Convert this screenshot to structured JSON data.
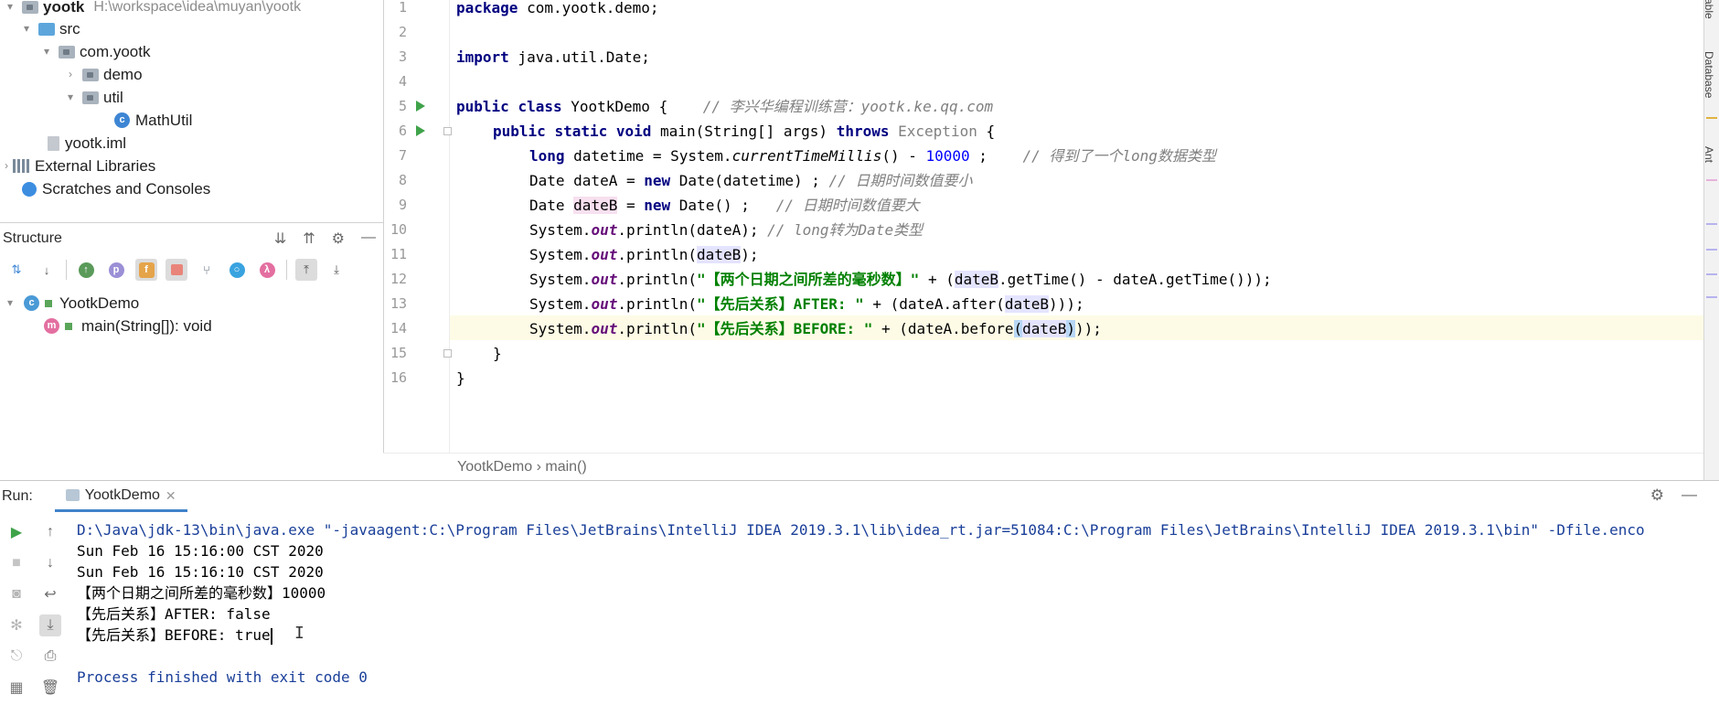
{
  "project": {
    "root_name": "yootk",
    "root_path": "H:\\workspace\\idea\\muyan\\yootk",
    "items": [
      {
        "label": "src"
      },
      {
        "label": "com.yootk"
      },
      {
        "label": "demo"
      },
      {
        "label": "util"
      },
      {
        "label": "MathUtil"
      },
      {
        "label": "yootk.iml"
      },
      {
        "label": "External Libraries"
      },
      {
        "label": "Scratches and Consoles"
      }
    ]
  },
  "structure": {
    "title": "Structure",
    "nodes": [
      {
        "label": "YootkDemo"
      },
      {
        "label": "main(String[]): void"
      }
    ],
    "icon_letters": [
      "p",
      "f",
      "λ"
    ]
  },
  "editor": {
    "line_numbers": [
      "1",
      "2",
      "3",
      "4",
      "5",
      "6",
      "7",
      "8",
      "9",
      "10",
      "11",
      "12",
      "13",
      "14",
      "15",
      "16"
    ],
    "lines": [
      {
        "k1": "package",
        "t1": " com.yootk.demo;"
      },
      {},
      {
        "k1": "import",
        "t1": " java.util.Date;"
      },
      {},
      {
        "k1": "public",
        "t1": " ",
        "k2": "class",
        "t2": " YootkDemo {    ",
        "cmt": "// 李兴华编程训练营：yootk.ke.qq.com"
      },
      {
        "k1": "public",
        "t1": " ",
        "k2": "static",
        "t2": " ",
        "k3": "void",
        "t3": " main(String[] args) ",
        "k4": "throws",
        "t4": " ",
        "gray": "Exception",
        "t5": " {"
      },
      {
        "k1": "long",
        "t1": " datetime = System.",
        "stat": "currentTimeMillis",
        "t2": "() - ",
        "num": "10000",
        "t3": " ;    ",
        "cmt": "// 得到了一个long数据类型"
      },
      {
        "t1": "Date dateA = ",
        "k1": "new",
        "t2": " Date(datetime) ; ",
        "cmt": "// 日期时间数值要小"
      },
      {
        "t1": "Date ",
        "hl": "dateB",
        "t2": " = ",
        "k1": "new",
        "t3": " Date() ;   ",
        "cmt": "// 日期时间数值要大"
      },
      {
        "t1": "System.",
        "fld": "out",
        "t2": ".println(dateA); ",
        "cmt": "// long转为Date类型"
      },
      {
        "t1": "System.",
        "fld": "out",
        "t2": ".println(",
        "hl": "dateB",
        "t3": ");"
      },
      {
        "t1": "System.",
        "fld": "out",
        "t2": ".println(",
        "str": "\"【两个日期之间所差的毫秒数】\"",
        "t3": " + (",
        "hl": "dateB",
        "t4": ".getTime() - dateA.getTime()));"
      },
      {
        "t1": "System.",
        "fld": "out",
        "t2": ".println(",
        "str": "\"【先后关系】AFTER: \"",
        "t3": " + (dateA.after(",
        "hl": "dateB",
        "t4": ")));"
      },
      {
        "t1": "System.",
        "fld": "out",
        "t2": ".println(",
        "str": "\"【先后关系】BEFORE: \"",
        "t3": " + (dateA.before",
        "br1": "(",
        "hl": "dateB",
        "br2": ")",
        "t4": "));"
      },
      {
        "t1": "}"
      },
      {
        "t1": "}"
      }
    ],
    "breadcrumb": [
      "YootkDemo",
      "main()"
    ]
  },
  "right_strip": {
    "tabs": [
      "Table",
      "Database",
      "Ant"
    ]
  },
  "run": {
    "label": "Run:",
    "tab": "YootkDemo",
    "console": [
      "D:\\Java\\jdk-13\\bin\\java.exe \"-javaagent:C:\\Program Files\\JetBrains\\IntelliJ IDEA 2019.3.1\\lib\\idea_rt.jar=51084:C:\\Program Files\\JetBrains\\IntelliJ IDEA 2019.3.1\\bin\" -Dfile.enco",
      "Sun Feb 16 15:16:00 CST 2020",
      "Sun Feb 16 15:16:10 CST 2020",
      "【两个日期之间所差的毫秒数】10000",
      "【先后关系】AFTER: false",
      "【先后关系】BEFORE: true",
      "",
      "Process finished with exit code 0"
    ]
  },
  "colors": {
    "keyword": "#000080",
    "string": "#008000",
    "number": "#0000ff",
    "comment": "#808080",
    "field": "#660e7a",
    "run_green": "#3fa34a",
    "current_line": "#fdfbe6"
  }
}
